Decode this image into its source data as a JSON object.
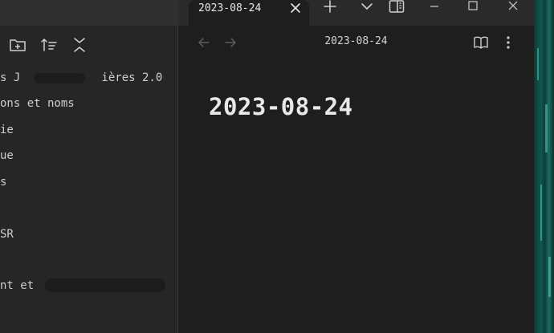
{
  "tab": {
    "title": "2023-08-24"
  },
  "sidebar": {
    "items": [
      {
        "label": "s J            ières 2.0"
      },
      {
        "label": "ons et noms"
      },
      {
        "label": "ie"
      },
      {
        "label": "ue"
      },
      {
        "label": "s"
      },
      {
        "label": ""
      },
      {
        "label": "SR"
      },
      {
        "label": ""
      },
      {
        "label": "nt et "
      }
    ]
  },
  "main": {
    "view_title": "2023-08-24",
    "doc_title": "2023-08-24"
  },
  "icons": {
    "new_folder": "new-folder-icon",
    "sort": "sort-icon",
    "collapse": "collapse-all-icon",
    "back": "arrow-left-icon",
    "forward": "arrow-right-icon",
    "reading_mode": "book-open-icon",
    "more": "more-vertical-icon",
    "new_tab": "plus-icon",
    "tab_list": "chevron-down-icon",
    "sidebar_toggle": "sidebar-right-icon",
    "minimize": "minimize-icon",
    "maximize": "maximize-icon",
    "close": "close-icon"
  }
}
